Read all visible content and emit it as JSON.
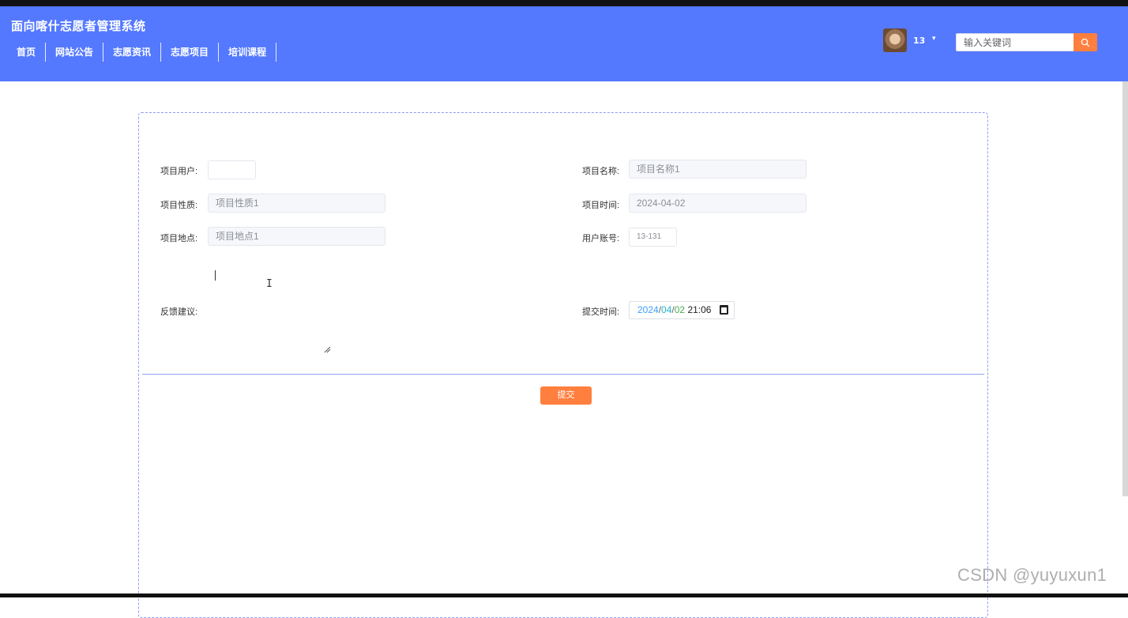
{
  "app": {
    "title": "面向喀什志愿者管理系统",
    "nav": [
      "首页",
      "网站公告",
      "志愿资讯",
      "志愿项目",
      "培训课程"
    ],
    "user": {
      "name": "13",
      "caret": "▾"
    },
    "search": {
      "placeholder": "输入关键词",
      "icon": "search-icon"
    },
    "colors": {
      "header": "#5479ff",
      "accent": "#ff7f3e"
    }
  },
  "form": {
    "xiangmu_yonghu": {
      "label": "项目用户:",
      "value": ""
    },
    "xiangmu_mingcheng": {
      "label": "项目名称:",
      "value": "项目名称1"
    },
    "xiangmu_xingzhi": {
      "label": "项目性质:",
      "value": "项目性质1"
    },
    "xiangmu_shijian": {
      "label": "项目时间:",
      "value": "2024-04-02"
    },
    "xiangmu_didian": {
      "label": "项目地点:",
      "value": "项目地点1"
    },
    "yonghu_zhanghao": {
      "label": "用户账号:",
      "value": "13-131"
    },
    "fankui_jianyi": {
      "label": "反馈建议:",
      "value": ""
    },
    "tijiao_shijian": {
      "label": "提交时间:",
      "year": "2024",
      "sep1": "/",
      "month": "04",
      "sep2": "/",
      "day": "02",
      "time": "21:06",
      "icon": "calendar-icon"
    },
    "submit_label": "提交"
  },
  "watermark": "CSDN @yuyuxun1"
}
